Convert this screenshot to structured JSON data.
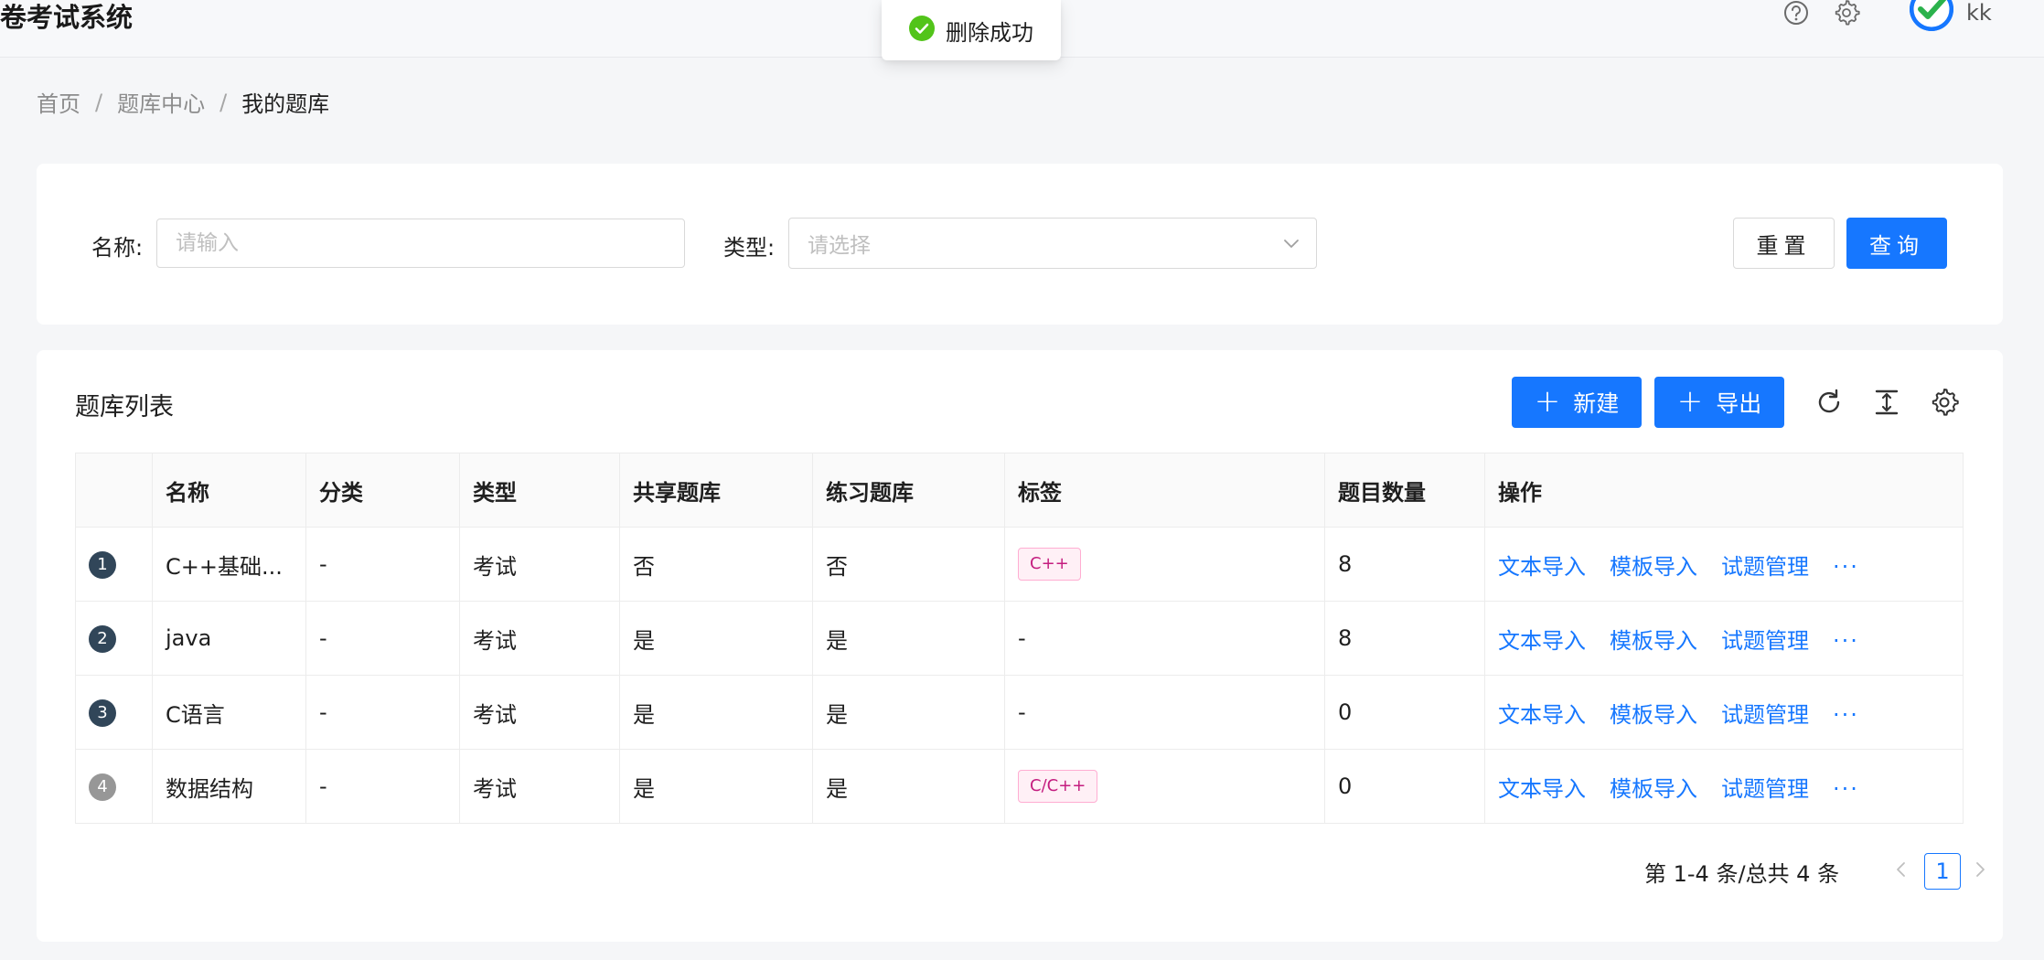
{
  "header": {
    "app_title": "卷考试系统",
    "help_icon": "question-circle-icon",
    "settings_icon": "gear-icon",
    "user_name": "kk"
  },
  "toast": {
    "icon": "check-circle-icon",
    "message": "删除成功",
    "color": "#52c41a"
  },
  "breadcrumb": [
    {
      "label": "首页"
    },
    {
      "label": "题库中心"
    },
    {
      "label": "我的题库"
    }
  ],
  "breadcrumb_separator": "/",
  "filter": {
    "name_label": "名称:",
    "name_placeholder": "请输入",
    "type_label": "类型:",
    "type_placeholder": "请选择",
    "reset_label": "重置",
    "query_label": "查询"
  },
  "list": {
    "title": "题库列表",
    "new_label": "新建",
    "export_label": "导出",
    "columns": [
      "",
      "名称",
      "分类",
      "类型",
      "共享题库",
      "练习题库",
      "标签",
      "题目数量",
      "操作"
    ],
    "rows": [
      {
        "index": "1",
        "name": "C++基础...",
        "category": "-",
        "type": "考试",
        "shared": "否",
        "practice": "否",
        "tag": "C++",
        "count": "8"
      },
      {
        "index": "2",
        "name": "java",
        "category": "-",
        "type": "考试",
        "shared": "是",
        "practice": "是",
        "tag": "-",
        "count": "8"
      },
      {
        "index": "3",
        "name": "C语言",
        "category": "-",
        "type": "考试",
        "shared": "是",
        "practice": "是",
        "tag": "-",
        "count": "0"
      },
      {
        "index": "4",
        "name": "数据结构",
        "category": "-",
        "type": "考试",
        "shared": "是",
        "practice": "是",
        "tag": "C/C++",
        "count": "0"
      }
    ],
    "actions": {
      "text_import": "文本导入",
      "template_import": "模板导入",
      "question_manage": "试题管理",
      "more": "···"
    }
  },
  "pagination": {
    "summary": "第 1-4 条/总共 4 条",
    "current_page": "1"
  },
  "colors": {
    "primary": "#1677ff",
    "tag_border": "#ffadd2",
    "tag_text": "#c41d7f"
  }
}
